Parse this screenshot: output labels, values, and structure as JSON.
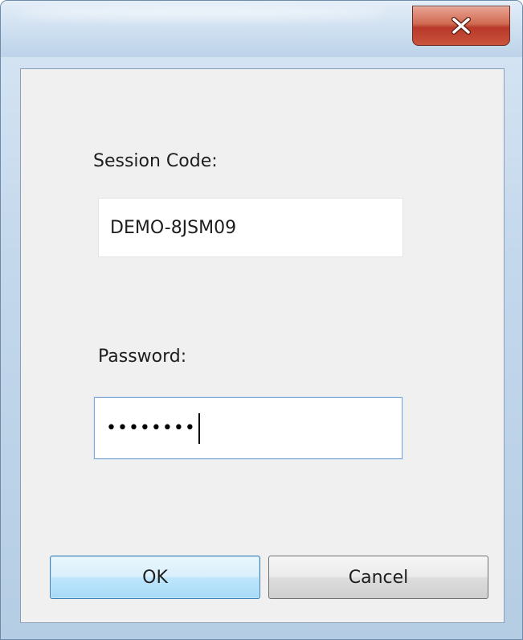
{
  "window": {
    "close_icon": "close-x-icon"
  },
  "form": {
    "session_code_label": "Session Code:",
    "session_code_value": "DEMO-8JSM09",
    "password_label": "Password:",
    "password_mask": "••••••••"
  },
  "buttons": {
    "ok_label": "OK",
    "cancel_label": "Cancel"
  },
  "colors": {
    "close_button": "#c9543c",
    "focus_border": "#7fa9d3",
    "default_button_border": "#3c7fb1"
  }
}
